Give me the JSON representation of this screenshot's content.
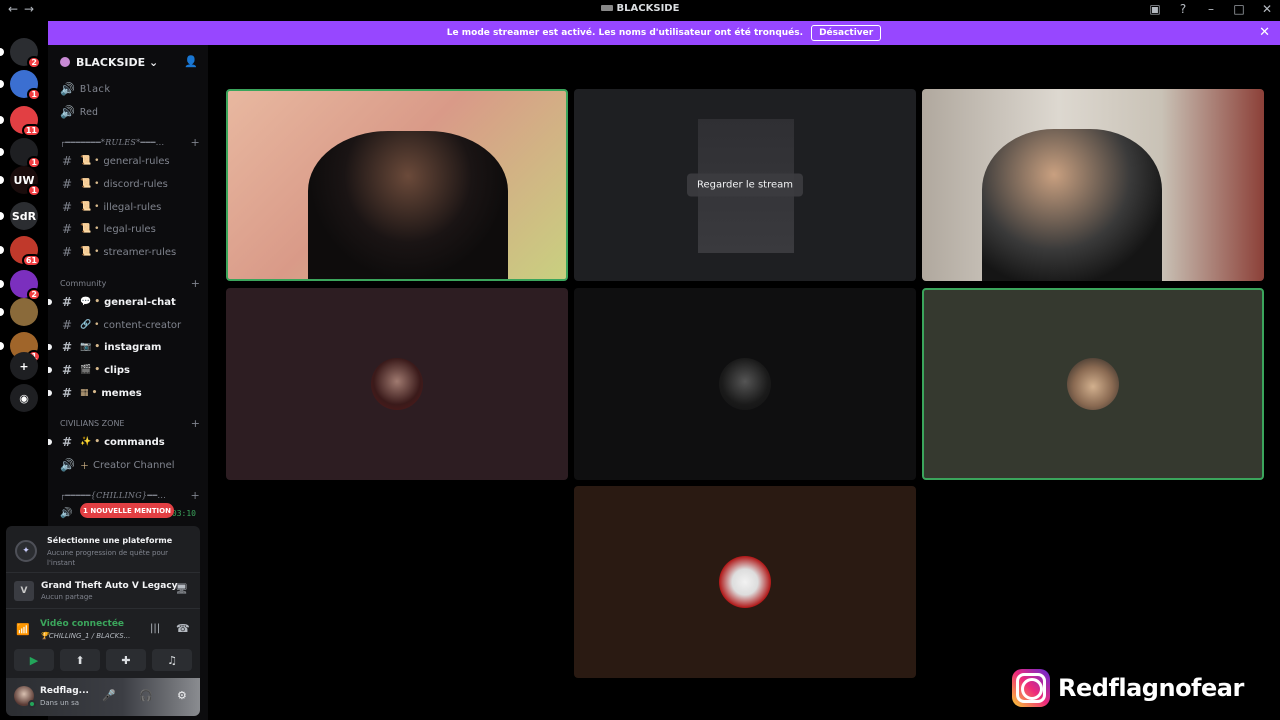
{
  "window": {
    "title": "BLACKSIDE",
    "controls": [
      "inbox-icon",
      "help-icon",
      "minimize-icon",
      "maximize-icon",
      "close-icon"
    ]
  },
  "banner": {
    "text": "Le mode streamer est activé. Les noms d'utilisateur ont été tronqués.",
    "button": "Désactiver"
  },
  "server_rail": {
    "items": [
      {
        "name": "discord-home-icon",
        "label": "",
        "badge": "2",
        "color": "#2b2d31"
      },
      {
        "name": "server-blue",
        "label": "",
        "badge": "1",
        "color": "#3b6fd1"
      },
      {
        "name": "server-red-logo",
        "label": "",
        "badge": "11",
        "color": "#e23f43"
      },
      {
        "name": "server-blackside",
        "label": "",
        "badge": "1",
        "color": "#1e1f22"
      },
      {
        "name": "server-uw",
        "label": "UW",
        "badge": "1",
        "color": "#1a0c0c"
      },
      {
        "name": "server-sdr",
        "label": "SdR",
        "badge": "",
        "color": "#2b2d31"
      },
      {
        "name": "server-wings",
        "label": "",
        "badge": "61",
        "color": "#c0392b"
      },
      {
        "name": "server-purple",
        "label": "",
        "badge": "2",
        "color": "#7b2fbe"
      },
      {
        "name": "server-avatar-1",
        "label": "",
        "badge": "",
        "color": "#8a6a3a"
      },
      {
        "name": "server-avatar-2",
        "label": "",
        "badge": "1",
        "color": "#a0652a"
      }
    ],
    "add_server": "+",
    "discover": "◉"
  },
  "sidebar": {
    "guild_name": "BLACKSIDE",
    "voice_top": [
      "Black",
      "Red"
    ],
    "categories": {
      "rules": "┌━━━━━━━*RULES*━━━...",
      "community": "Community",
      "civilians": "CIVILIANS ZONE",
      "chilling": "┌━━━━━{CHILLING}━━..."
    },
    "rules_channels": [
      "general-rules",
      "discord-rules",
      "illegal-rules",
      "legal-rules",
      "streamer-rules"
    ],
    "community_channels": [
      "general-chat",
      "content-creator",
      "instagram",
      "clips",
      "memes"
    ],
    "civilians_channels": [
      "commands",
      "Creator Channel"
    ],
    "mention_badge": "1 NOUVELLE MENTION",
    "chilling_time": "03:10"
  },
  "quest": {
    "title": "Sélectionne une plateforme",
    "subtitle": "Aucune progression de quête pour l'instant"
  },
  "activity": {
    "game": "Grand Theft Auto V Legacy",
    "status": "Aucun partage"
  },
  "voice": {
    "status": "Vidéo connectée",
    "channel": "🏆CHILLING_1 / BLACKS..."
  },
  "user": {
    "name": "Redflag...",
    "status": "Dans un sa"
  },
  "video": {
    "stream_button": "Regarder le stream"
  },
  "watermark": {
    "handle": "Redflagnofear"
  },
  "colors": {
    "accent": "#9747ff",
    "speaking": "#3ba55c",
    "mention": "#e23f43"
  }
}
